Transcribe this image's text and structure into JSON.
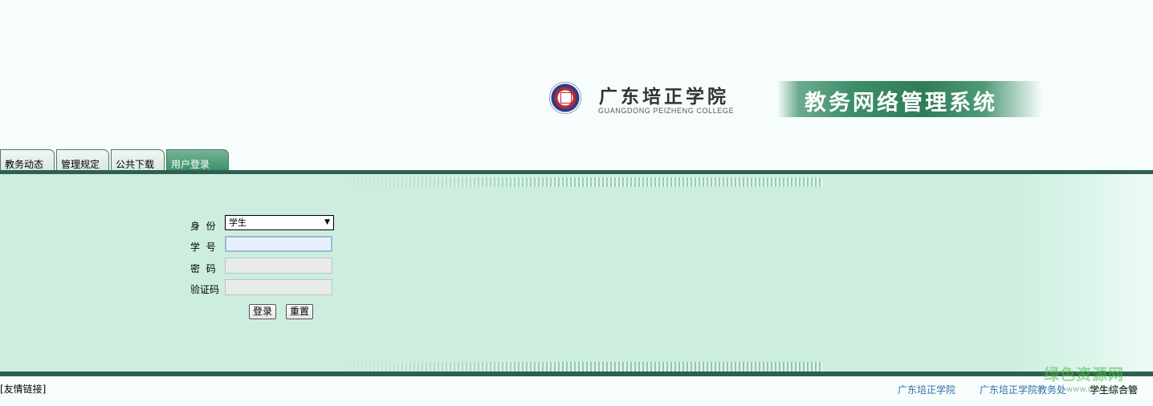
{
  "header": {
    "college_name_cn": "广东培正学院",
    "college_name_en": "GUANGDONG PEIZHENG COLLEGE",
    "system_title": "教务网络管理系统"
  },
  "tabs": [
    {
      "label": "教务动态",
      "active": false
    },
    {
      "label": "管理规定",
      "active": false
    },
    {
      "label": "公共下载",
      "active": false
    },
    {
      "label": "用户登录",
      "active": true
    }
  ],
  "login_form": {
    "identity_label": "身  份",
    "identity_value": "学生",
    "student_id_label": "学  号",
    "student_id_value": "",
    "password_label": "密  码",
    "password_value": "",
    "captcha_label": "验证码",
    "captcha_value": "",
    "login_button": "登录",
    "reset_button": "重置"
  },
  "footer": {
    "links_label": "[友情链接]",
    "links": [
      "广东培正学院",
      "广东培正学院教务处"
    ],
    "right_text": "学生综合管"
  },
  "watermark": {
    "text_cn": "绿色资源网",
    "text_en": "www.downcc.com"
  },
  "colors": {
    "accent_green": "#2e6050",
    "band_green": "#cdeedf",
    "active_tab": "#4f9c78",
    "link_blue": "#2f6fa8"
  }
}
